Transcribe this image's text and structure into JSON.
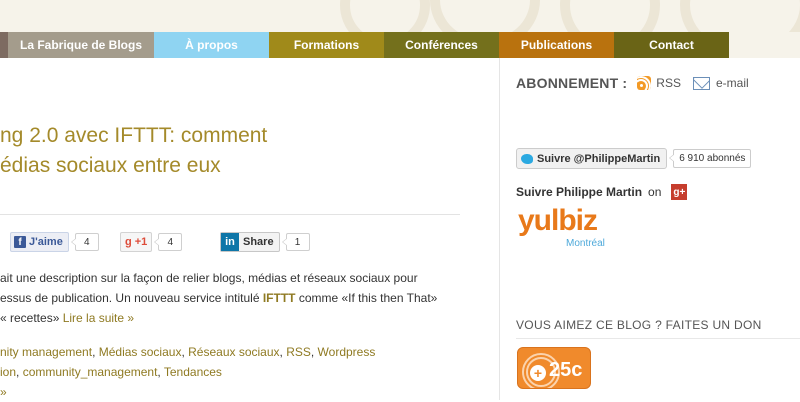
{
  "nav": {
    "items": [
      {
        "label": "La Fabrique de Blogs",
        "color": "#a49c8c"
      },
      {
        "label": "À propos",
        "color": "#8fd4f2"
      },
      {
        "label": "Formations",
        "color": "#a08a1a"
      },
      {
        "label": "Conférences",
        "color": "#74701c"
      },
      {
        "label": "Publications",
        "color": "#b9720e"
      },
      {
        "label": "Contact",
        "color": "#6a6416"
      }
    ]
  },
  "post": {
    "title_line1": "ng 2.0 avec IFTTT: comment",
    "title_line2": "édias sociaux entre eux",
    "social": {
      "facebook_label": "J'aime",
      "facebook_count": "4",
      "gplus_label": "+1",
      "gplus_count": "4",
      "linkedin_label": "Share",
      "linkedin_count": "1"
    },
    "excerpt": {
      "line1": "ait une description sur la façon de relier blogs, médias et réseaux sociaux pour",
      "line2_a": "essus de publication.  Un nouveau service intitulé ",
      "line2_b": "IFTTT",
      "line2_c": " comme «If this then That»",
      "line3_a": " « recettes» ",
      "read_more": "Lire la suite »"
    },
    "categories": {
      "c1": "nity management",
      "c2": "Médias sociaux",
      "c3": "Réseaux sociaux",
      "c4": "RSS",
      "c5": "Wordpress"
    },
    "tags": {
      "t1": "ion",
      "t2": "community_management",
      "t3": "Tendances"
    },
    "more_arrow": "»"
  },
  "sidebar": {
    "abonnement_label": "ABONNEMENT :",
    "rss_label": "RSS",
    "email_label": "e-mail",
    "twitter_button": "Suivre @PhilippeMartin",
    "twitter_count": "6 910 abonnés",
    "follow_text": "Suivre Philippe Martin",
    "follow_on": "on",
    "gplus_icon_label": "g+",
    "yulbiz_word": "yulbiz",
    "yulbiz_city": "Montréal",
    "donation_heading": "VOUS AIMEZ CE BLOG ? FAITES UN DON",
    "flattr_amount": "25c",
    "flattr_plus": "+"
  }
}
